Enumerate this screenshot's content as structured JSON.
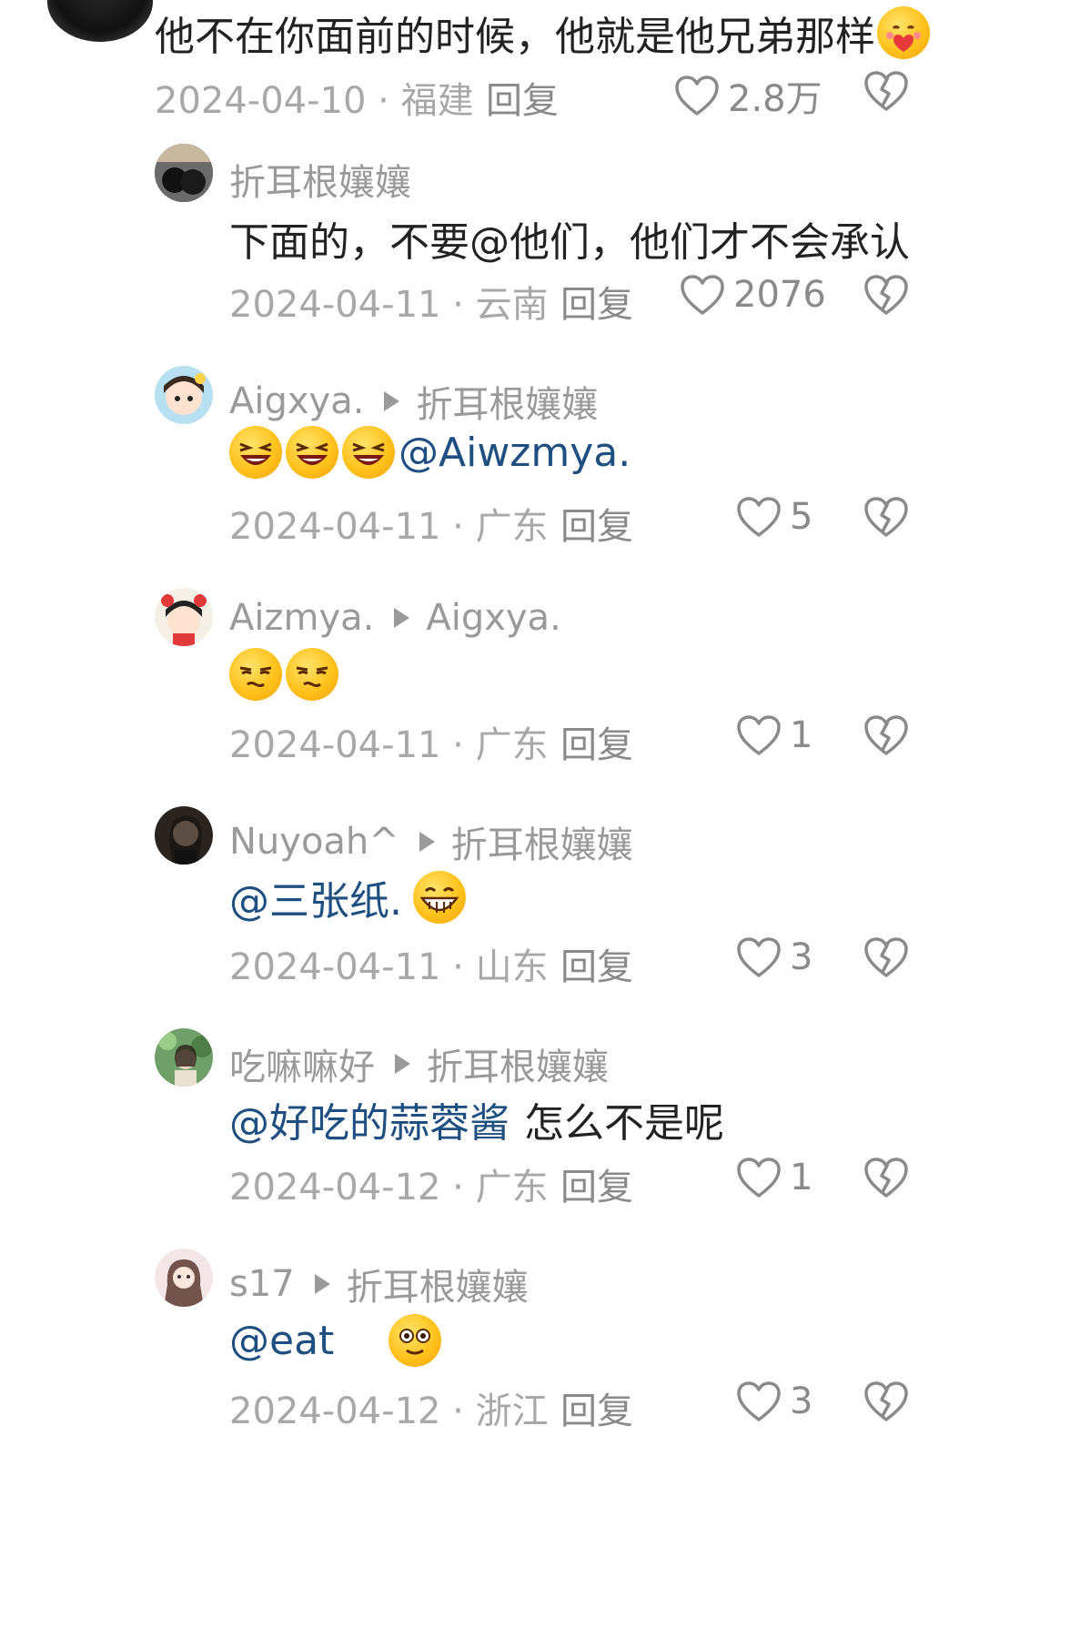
{
  "comments": [
    {
      "text": "他不在你面前的时候，他就是他兄弟那样",
      "date": "2024-04-10",
      "region": "福建",
      "reply_label": "回复",
      "likes": "2.8万"
    },
    {
      "author": "折耳根孃孃",
      "text": "下面的，不要@他们，他们才不会承认",
      "date": "2024-04-11",
      "region": "云南",
      "reply_label": "回复",
      "likes": "2076"
    },
    {
      "author": "Aigxya.",
      "reply_to": "折耳根孃孃",
      "mention": "@Aiwzmya.",
      "date": "2024-04-11",
      "region": "广东",
      "reply_label": "回复",
      "likes": "5"
    },
    {
      "author": "Aizmya.",
      "reply_to": "Aigxya.",
      "date": "2024-04-11",
      "region": "广东",
      "reply_label": "回复",
      "likes": "1"
    },
    {
      "author": "Nuyoah^",
      "reply_to": "折耳根孃孃",
      "mention": "@三张纸.",
      "date": "2024-04-11",
      "region": "山东",
      "reply_label": "回复",
      "likes": "3"
    },
    {
      "author": "吃嘛嘛好",
      "reply_to": "折耳根孃孃",
      "mention": "@好吃的蒜蓉酱",
      "text": "怎么不是呢",
      "date": "2024-04-12",
      "region": "广东",
      "reply_label": "回复",
      "likes": "1"
    },
    {
      "author": "s17",
      "reply_to": "折耳根孃孃",
      "mention": "@eat",
      "date": "2024-04-12",
      "region": "浙江",
      "reply_label": "回复",
      "likes": "3"
    }
  ],
  "separator": " · ",
  "colors": {
    "mention": "#1f4f80",
    "meta": "#a8a8a8",
    "text": "#222222"
  }
}
